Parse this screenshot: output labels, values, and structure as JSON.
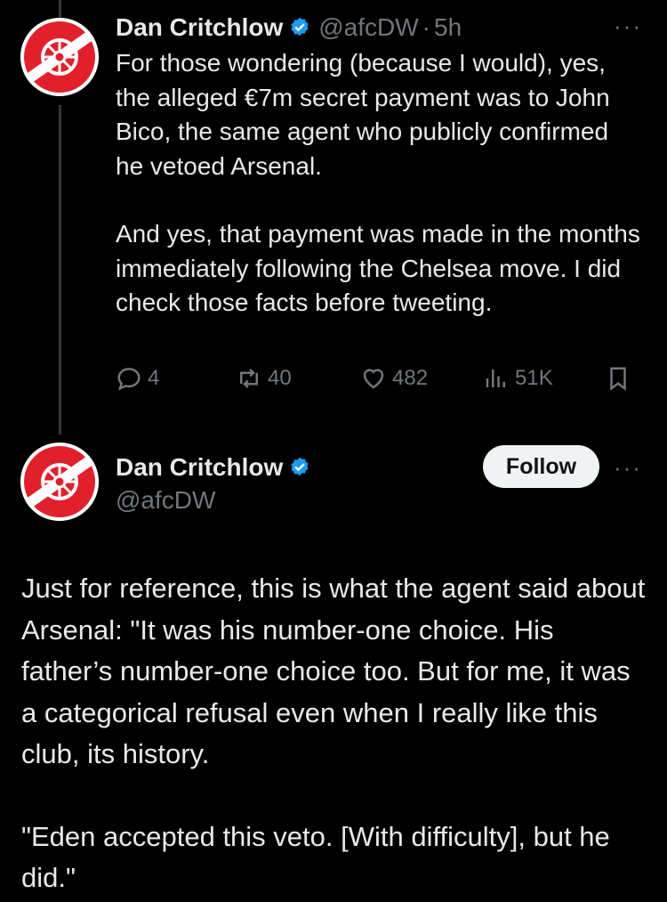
{
  "tweet1": {
    "name": "Dan Critchlow",
    "handle": "@afcDW",
    "separator": "·",
    "time": "5h",
    "more": "···",
    "paragraphs": [
      "For those wondering (because I would), yes, the alleged €7m secret payment was to John Bico, the same agent who publicly confirmed he vetoed Arsenal.",
      "And yes, that payment was made in the months immediately following the Chelsea move. I did check those facts before tweeting."
    ],
    "replies": "4",
    "reposts": "40",
    "likes": "482",
    "views": "51K"
  },
  "tweet2": {
    "name": "Dan Critchlow",
    "handle": "@afcDW",
    "follow_label": "Follow",
    "more": "···",
    "paragraphs": [
      "Just for reference, this is what the agent said about Arsenal: \"It was his number-one choice. His father’s number-one choice too. But for me, it was a categorical refusal even when I really like this club, its history.",
      "\"Eden accepted this veto. [With difficulty], but he did.\""
    ]
  },
  "colors": {
    "background": "#000000",
    "text": "#e7e9ea",
    "muted": "#71767b",
    "verified": "#1d9bf0",
    "avatar_red": "#e2202c"
  },
  "icons": [
    "verified-badge-icon",
    "reply-icon",
    "repost-icon",
    "like-icon",
    "views-icon",
    "bookmark-icon",
    "more-icon"
  ]
}
